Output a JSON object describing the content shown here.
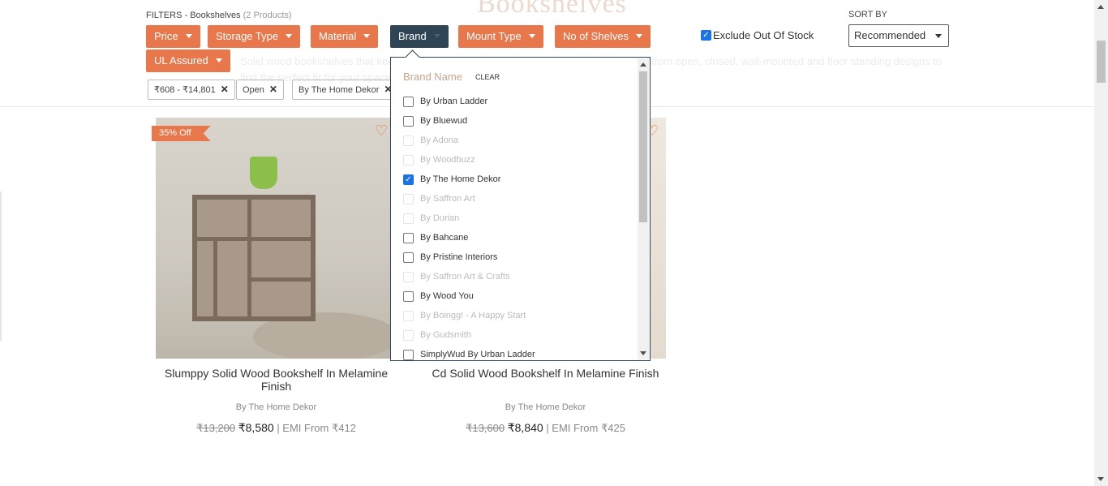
{
  "page": {
    "title": "Bookshelves",
    "description": "Solid wood bookshelves that keep your books organised and your room stylish. Choose from open, closed, wall-mounted and floor standing designs to find the perfect fit for your space."
  },
  "filters": {
    "label": "FILTERS - Bookshelves",
    "count": "(2 Products)",
    "chips": [
      {
        "label": "Price"
      },
      {
        "label": "Storage Type"
      },
      {
        "label": "Material"
      },
      {
        "label": "Brand"
      },
      {
        "label": "Mount Type"
      },
      {
        "label": "No of Shelves"
      },
      {
        "label": "UL Assured"
      }
    ],
    "exclude_out_of_stock": {
      "label": "Exclude Out Of Stock",
      "checked": true
    },
    "applied": [
      {
        "label": "₹608 - ₹14,801"
      },
      {
        "label": "Open"
      },
      {
        "label": "By The Home Dekor"
      }
    ]
  },
  "sort": {
    "label": "SORT BY",
    "value": "Recommended"
  },
  "brand_dropdown": {
    "heading": "Brand Name",
    "clear_label": "CLEAR",
    "items": [
      {
        "label": "By Urban Ladder",
        "state": "enabled"
      },
      {
        "label": "By Bluewud",
        "state": "enabled"
      },
      {
        "label": "By Adona",
        "state": "disabled"
      },
      {
        "label": "By Woodbuzz",
        "state": "disabled"
      },
      {
        "label": "By The Home Dekor",
        "state": "checked"
      },
      {
        "label": "By Saffron Art",
        "state": "disabled"
      },
      {
        "label": "By Durian",
        "state": "disabled"
      },
      {
        "label": "By Bahcane",
        "state": "enabled"
      },
      {
        "label": "By Pristine Interiors",
        "state": "enabled"
      },
      {
        "label": "By Saffron Art & Crafts",
        "state": "disabled"
      },
      {
        "label": "By Wood You",
        "state": "enabled"
      },
      {
        "label": "By Boingg! - A Happy Start",
        "state": "disabled"
      },
      {
        "label": "By Gudsmith",
        "state": "disabled"
      },
      {
        "label": "SimplyWud By Urban Ladder",
        "state": "enabled"
      }
    ]
  },
  "products": [
    {
      "badge": "35% Off",
      "title": "Slumppy Solid Wood Bookshelf In Melamine Finish",
      "brand": "By The Home Dekor",
      "old_price": "₹13,200",
      "price": "₹8,580",
      "emi": "| EMI From ₹412"
    },
    {
      "title": "Cd Solid Wood Bookshelf In Melamine Finish",
      "brand": "By The Home Dekor",
      "old_price": "₹13,600",
      "price": "₹8,840",
      "emi": "| EMI From ₹425"
    }
  ],
  "colors": {
    "accent": "#e8784c",
    "active_chip": "#2f4454",
    "checkbox": "#1a73e8"
  },
  "icons": {
    "chip_caret": "caret-down-icon",
    "remove": "close-icon",
    "wishlist": "heart-icon"
  }
}
